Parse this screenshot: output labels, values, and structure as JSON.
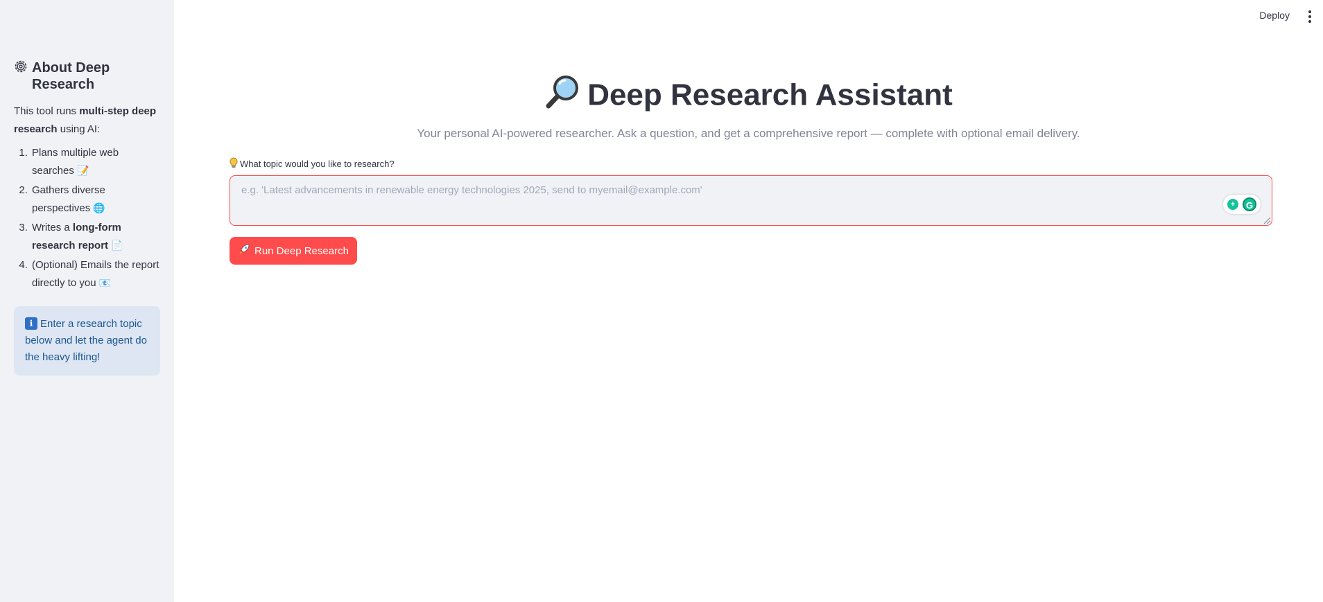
{
  "header": {
    "deploy_label": "Deploy"
  },
  "sidebar": {
    "title": "About Deep Research",
    "intro_prefix": "This tool runs ",
    "intro_bold": "multi-step deep research",
    "intro_suffix": " using AI:",
    "steps": [
      {
        "text": "Plans multiple web searches",
        "emoji": "📝"
      },
      {
        "text_prefix": "Gathers diverse perspectives",
        "emoji": "🌐"
      },
      {
        "text_prefix": "Writes a ",
        "text_bold": "long-form research report",
        "emoji": "📄"
      },
      {
        "text": "(Optional) Emails the report directly to you",
        "emoji": "📧"
      }
    ],
    "info_text": "Enter a research topic below and let the agent do the heavy lifting!"
  },
  "main": {
    "title": "Deep Research Assistant",
    "subtitle": "Your personal AI-powered researcher. Ask a question, and get a comprehensive report — complete with optional email delivery.",
    "input_label": "What topic would you like to research?",
    "input_placeholder": "e.g. 'Latest advancements in renewable energy technologies 2025, send to myemail@example.com'",
    "input_value": "",
    "run_button_label": "Run Deep Research"
  },
  "colors": {
    "accent": "#ff4b4b",
    "sidebar_bg": "#f0f2f6",
    "info_bg": "#dde6f2",
    "info_text": "#1b5694"
  },
  "icons": [
    "gear-icon",
    "magnifier-icon",
    "bulb-icon",
    "rocket-icon",
    "info-icon",
    "grammarly-icon",
    "menu-dots-icon"
  ]
}
